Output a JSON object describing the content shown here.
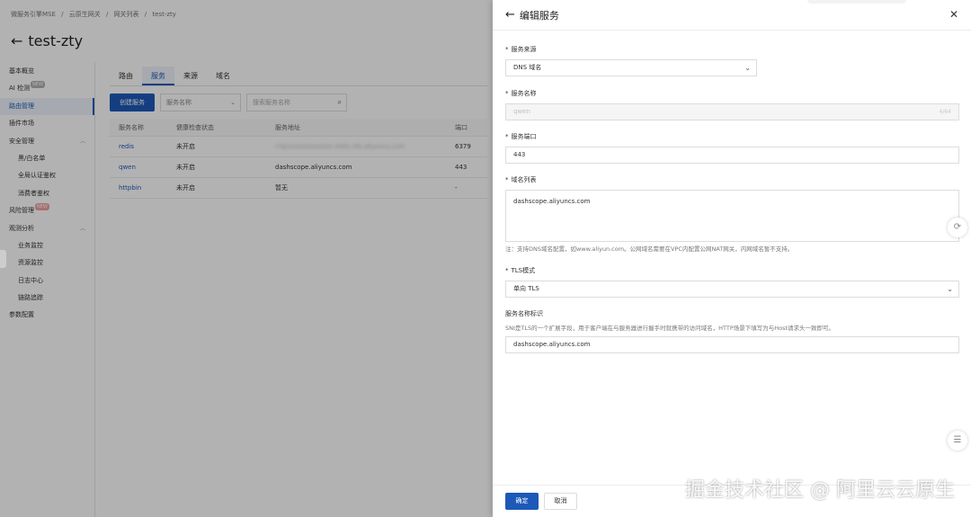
{
  "breadcrumb": [
    "微服务引擎MSE",
    "/",
    "云原生网关",
    "/",
    "网关列表",
    "/",
    "test-zty"
  ],
  "page": {
    "title": "test-zty"
  },
  "nav": {
    "items": [
      {
        "label": "基本概览",
        "sub": false
      },
      {
        "label": "AI 检测",
        "sub": false,
        "badge": "NEW"
      },
      {
        "label": "路由管理",
        "sub": false,
        "active": true
      },
      {
        "label": "插件市场",
        "sub": false
      },
      {
        "label": "安全管理",
        "sub": false,
        "caret": "^"
      },
      {
        "label": "黑/白名单",
        "sub": true
      },
      {
        "label": "全局认证鉴权",
        "sub": true
      },
      {
        "label": "消费者鉴权",
        "sub": true
      },
      {
        "label": "风险管理",
        "sub": false,
        "badge": "NEW"
      },
      {
        "label": "观测分析",
        "sub": false,
        "caret": "^"
      },
      {
        "label": "业务监控",
        "sub": true
      },
      {
        "label": "资源监控",
        "sub": true
      },
      {
        "label": "日志中心",
        "sub": true
      },
      {
        "label": "链路追踪",
        "sub": true
      },
      {
        "label": "参数配置",
        "sub": false
      }
    ]
  },
  "tabs": [
    "路由",
    "服务",
    "来源",
    "域名"
  ],
  "active_tab": 1,
  "toolbar": {
    "create_label": "创建服务",
    "filter_value": "服务名称",
    "search_placeholder": "搜索服务名称"
  },
  "table": {
    "columns": [
      "服务名称",
      "健康检查状态",
      "服务地址",
      "端口"
    ],
    "rows": [
      {
        "name": "redis",
        "status": "未开启",
        "address": "r-bp1xxxxxxxxxxx.redis.rds.aliyuncs.com",
        "port": "6379",
        "blurred": true
      },
      {
        "name": "qwen",
        "status": "未开启",
        "address": "dashscope.aliyuncs.com",
        "port": "443",
        "blurred": false
      },
      {
        "name": "httpbin",
        "status": "未开启",
        "address": "暂无",
        "port": "-",
        "blurred": false
      }
    ]
  },
  "drawer": {
    "title": "编辑服务",
    "source_label": "服务来源",
    "source_value": "DNS 域名",
    "name_label": "服务名称",
    "name_value": "qwen",
    "name_count": "4/64",
    "port_label": "服务端口",
    "port_value": "443",
    "domains_label": "域名列表",
    "domains_value": "dashscope.aliyuncs.com",
    "domains_help": "注：支持DNS域名配置，如www.aliyun.com。公网域名需要在VPC内配置公网NAT网关，内网域名暂不支持。",
    "tls_label": "TLS模式",
    "tls_value": "单向 TLS",
    "sni_label": "服务名称标识",
    "sni_help": "SNI是TLS的一个扩展字段，用于客户端在与服务器进行握手时就携带的访问域名，HTTP场景下填写为与Host请求头一致即可。",
    "sni_value": "dashscope.aliyuncs.com",
    "ok_label": "确定",
    "cancel_label": "取消"
  },
  "watermark": "掘金技术社区 @ 阿里云云原生",
  "colors": {
    "primary": "#1d59b9",
    "overlay": "rgba(0,0,0,0.30)"
  }
}
